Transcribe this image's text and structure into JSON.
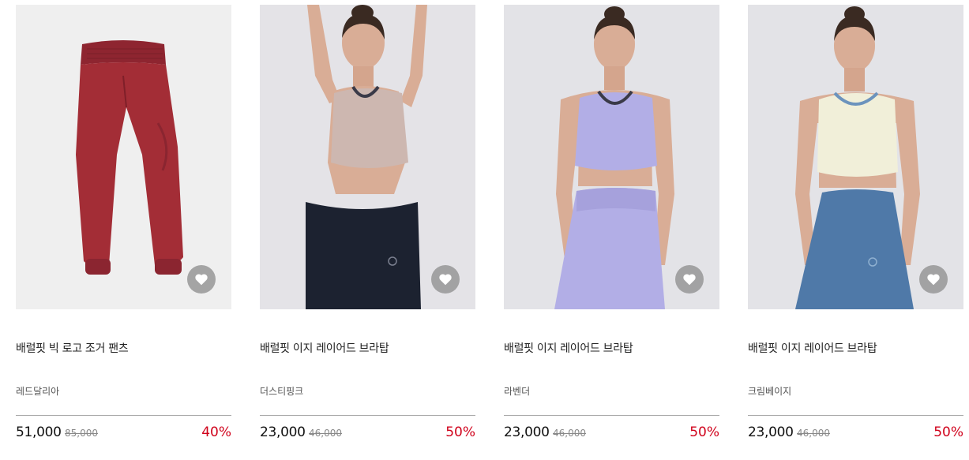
{
  "products": [
    {
      "name": "배럴핏 빅 로고 조거 팬츠",
      "color": "레드달리아",
      "price": "51,000",
      "original_price": "85,000",
      "discount": "40%",
      "image": "red-jogger-pants"
    },
    {
      "name": "배럴핏 이지 레이어드 브라탑",
      "color": "더스티핑크",
      "price": "23,000",
      "original_price": "46,000",
      "discount": "50%",
      "image": "model-dusty-pink-bratop"
    },
    {
      "name": "배럴핏 이지 레이어드 브라탑",
      "color": "라벤더",
      "price": "23,000",
      "original_price": "46,000",
      "discount": "50%",
      "image": "model-lavender-bratop"
    },
    {
      "name": "배럴핏 이지 레이어드 브라탑",
      "color": "크림베이지",
      "price": "23,000",
      "original_price": "46,000",
      "discount": "50%",
      "image": "model-cream-beige-bratop"
    }
  ],
  "like_icon": "heart-icon",
  "colors": {
    "discount": "#d0021b",
    "like_bg": "#969696",
    "pants": "#9e2b33",
    "pink_top": "#cdb7b0",
    "black_leggings": "#1c2230",
    "lavender": "#b2aee6",
    "cream_top": "#f1efd9",
    "blue_leggings": "#4f79a8"
  }
}
